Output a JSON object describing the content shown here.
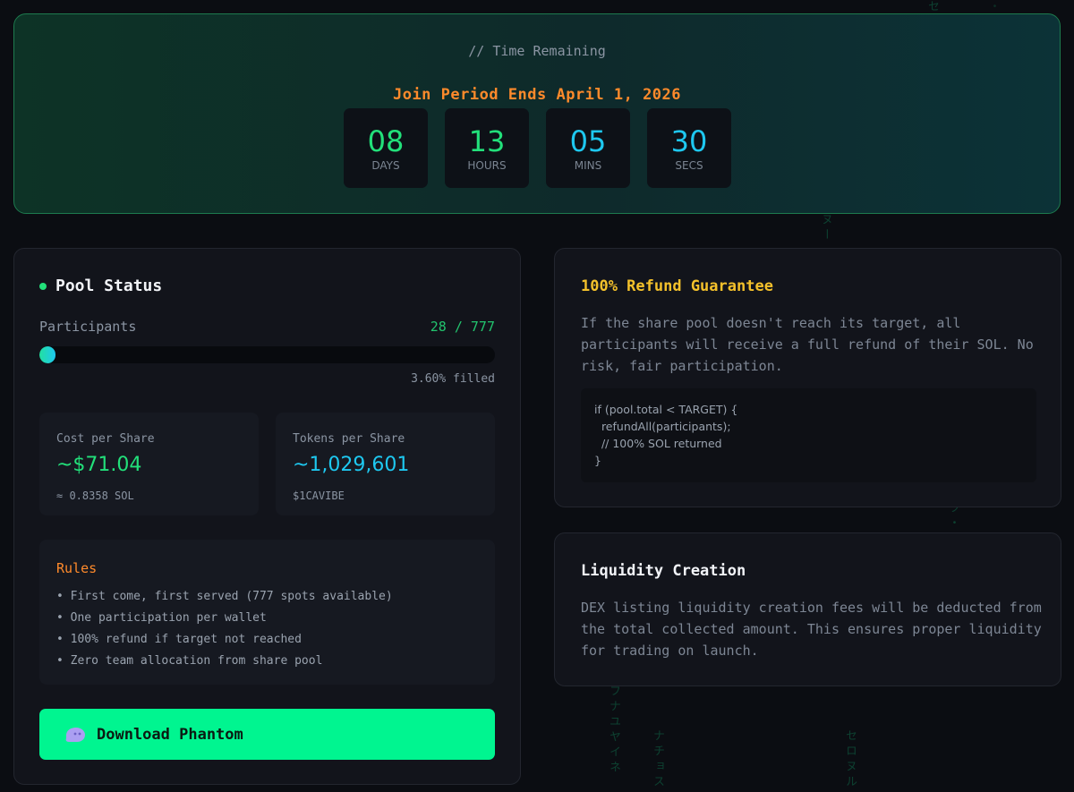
{
  "countdown": {
    "subtitle": "// Time Remaining",
    "title": "Join Period Ends April 1, 2026",
    "units": [
      {
        "value": "08",
        "label": "DAYS"
      },
      {
        "value": "13",
        "label": "HOURS"
      },
      {
        "value": "05",
        "label": "MINS"
      },
      {
        "value": "30",
        "label": "SECS"
      }
    ]
  },
  "pool": {
    "title": "Pool Status",
    "participants_label": "Participants",
    "participants_count": "28 / 777",
    "fill_fraction": 0.036,
    "filled_text": "3.60% filled",
    "cost": {
      "label": "Cost per Share",
      "value": "~$71.04",
      "sub": "≈ 0.8358 SOL"
    },
    "tokens": {
      "label": "Tokens per Share",
      "value": "~1,029,601",
      "sub": "$1CAVIBE"
    },
    "rules": {
      "title": "Rules",
      "items": [
        "First come, first served (777 spots available)",
        "One participation per wallet",
        "100% refund if target not reached",
        "Zero team allocation from share pool"
      ]
    },
    "button_label": "Download Phantom",
    "button_icon": "phantom-ghost-icon"
  },
  "refund": {
    "title": "100% Refund Guarantee",
    "text": "If the share pool doesn't reach its target, all participants will receive a full refund of their SOL. No risk, fair participation.",
    "code": "if (pool.total < TARGET) {\n  refundAll(participants);\n  // 100% SOL returned\n}"
  },
  "liquidity": {
    "title": "Liquidity Creation",
    "text": "DEX listing liquidity creation fees will be deducted from the total collected amount. This ensures proper liquidity for trading on launch."
  },
  "colors": {
    "accent_green": "#22e07a",
    "accent_cyan": "#1ec8f0",
    "accent_orange": "#ff8a2b",
    "accent_yellow": "#f4c12b",
    "button": "#00f590"
  }
}
